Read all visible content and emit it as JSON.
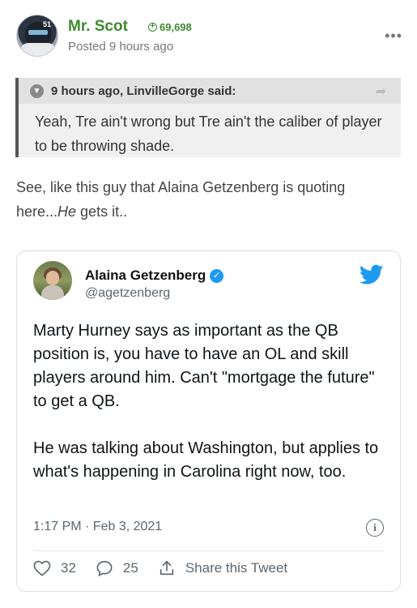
{
  "post": {
    "author": "Mr. Scot",
    "reputation": "69,698",
    "posted": "Posted 9 hours ago",
    "more_icon": "ellipsis-icon",
    "avatar_number": "51"
  },
  "quote": {
    "header": "9 hours ago, LinvilleGorge said:",
    "text": "Yeah, Tre ain't wrong but Tre ain't the caliber of player to be throwing shade."
  },
  "body": {
    "text_before": "See, like this guy that Alaina Getzenberg is quoting here...",
    "text_em": "He",
    "text_after": " gets it.."
  },
  "tweet": {
    "name": "Alaina Getzenberg",
    "handle": "@agetzenberg",
    "paragraph1": "Marty Hurney says as important as the QB position is, you have to have an OL and skill players around him. Can't \"mortgage the future\" to get a QB.",
    "paragraph2": "He was talking about Washington, but applies to what's happening in Carolina right now, too.",
    "timestamp": "1:17 PM · Feb 3, 2021",
    "likes": "32",
    "replies": "25",
    "share_label": "Share this Tweet"
  },
  "colors": {
    "author_green": "#3e8a2e",
    "twitter_blue": "#1d9bf0",
    "quote_border": "#555555"
  }
}
